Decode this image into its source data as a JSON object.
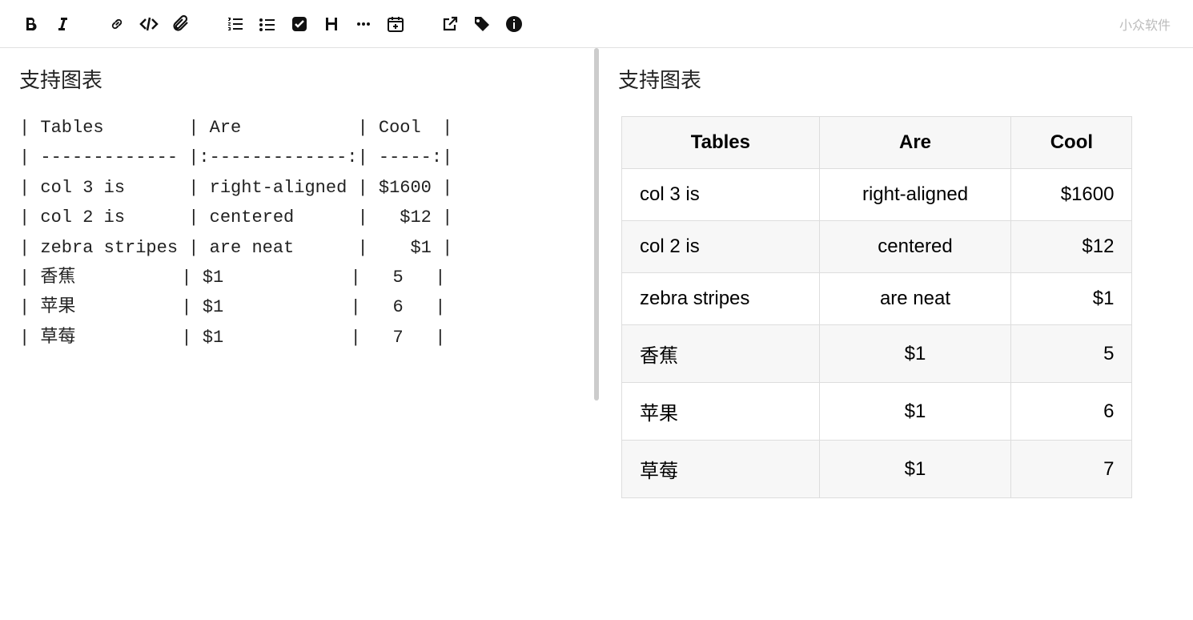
{
  "watermark": "小众软件",
  "source": {
    "title": "支持图表",
    "lines": [
      "| Tables        | Are           | Cool  |",
      "| ------------- |:-------------:| -----:|",
      "| col 3 is      | right-aligned | $1600 |",
      "| col 2 is      | centered      |   $12 |",
      "| zebra stripes | are neat      |    $1 |",
      "| 香蕉          | $1            |   5   |",
      "| 苹果          | $1            |   6   |",
      "| 草莓          | $1            |   7   |"
    ]
  },
  "preview": {
    "title": "支持图表",
    "headers": [
      "Tables",
      "Are",
      "Cool"
    ],
    "rows": [
      [
        "col 3 is",
        "right-aligned",
        "$1600"
      ],
      [
        "col 2 is",
        "centered",
        "$12"
      ],
      [
        "zebra stripes",
        "are neat",
        "$1"
      ],
      [
        "香蕉",
        "$1",
        "5"
      ],
      [
        "苹果",
        "$1",
        "6"
      ],
      [
        "草莓",
        "$1",
        "7"
      ]
    ]
  }
}
